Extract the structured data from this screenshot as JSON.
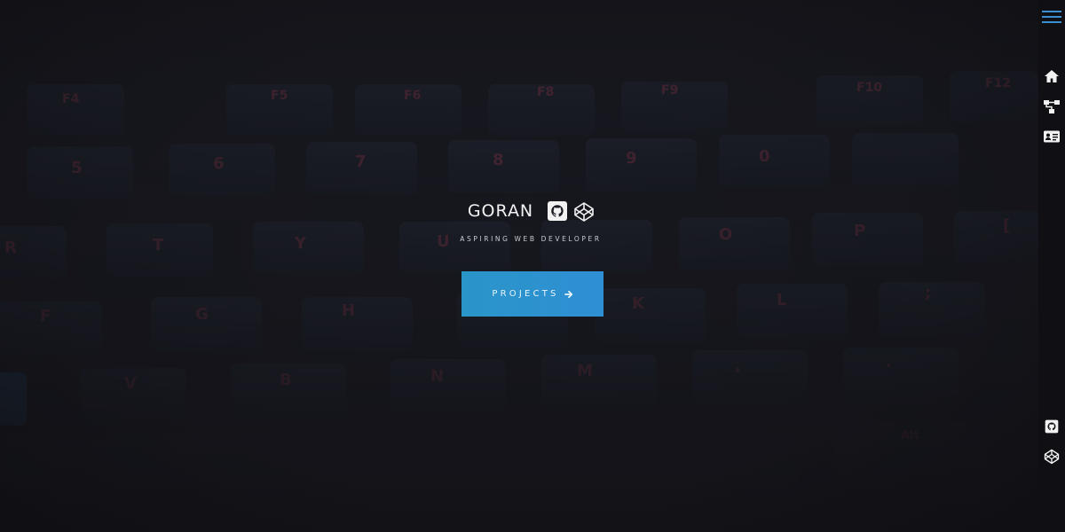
{
  "hero": {
    "name": "GORAN",
    "tagline": "ASPIRING WEB DEVELOPER",
    "cta_label": "PROJECTS",
    "accent_color": "#2a95c9",
    "icons": [
      "github-icon",
      "codepen-icon"
    ]
  },
  "background": {
    "description_keys": [
      "F4",
      "F5",
      "F6",
      "F8",
      "F9",
      "F10",
      "F12",
      "5",
      "6",
      "7",
      "8",
      "9",
      "0",
      "R",
      "T",
      "Y",
      "U",
      "I",
      "O",
      "P",
      "[",
      "F",
      "G",
      "H",
      "J",
      "K",
      "L",
      ";",
      "V",
      "B",
      "N",
      "M",
      ",",
      ".",
      "Alt"
    ]
  },
  "sidebar": {
    "menu_icon": "hamburger-menu-icon",
    "nav": [
      {
        "name": "home",
        "icon": "home-icon"
      },
      {
        "name": "projects",
        "icon": "sitemap-icon"
      },
      {
        "name": "about",
        "icon": "id-card-icon"
      }
    ],
    "social": [
      {
        "name": "github",
        "icon": "github-square-icon"
      },
      {
        "name": "codepen",
        "icon": "codepen-icon"
      }
    ]
  }
}
